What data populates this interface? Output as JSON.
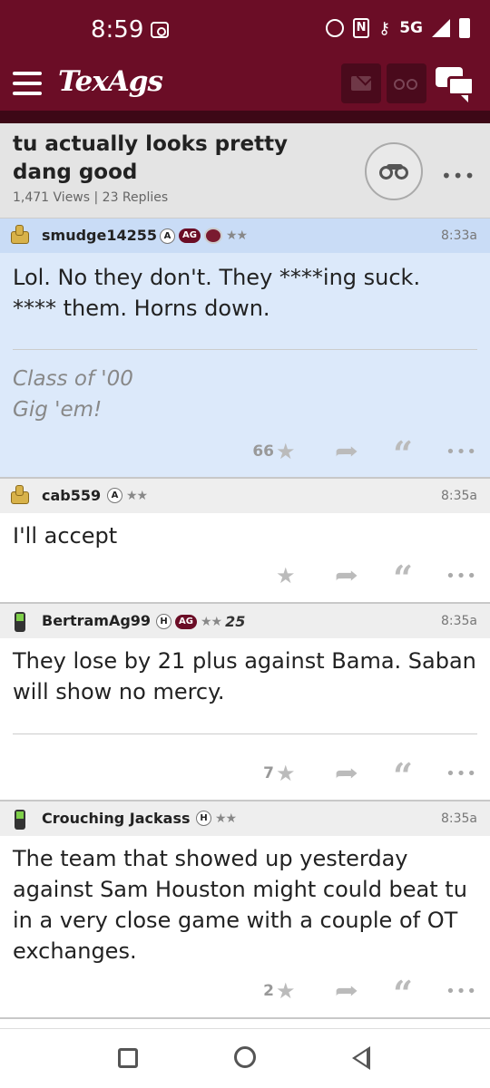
{
  "status_bar": {
    "time": "8:59",
    "network": "5G"
  },
  "app": {
    "name": "TexAgs"
  },
  "topic": {
    "title": "tu actually looks pretty dang good",
    "meta": "1,471 Views | 23 Replies"
  },
  "posts": [
    {
      "username": "smudge14255",
      "time": "8:33a",
      "badges": [
        "A",
        "AG"
      ],
      "stars": "★★",
      "body_lines": [
        "Lol. No they don't. They ****ing suck.",
        "**** them. Horns down."
      ],
      "signature_lines": [
        "Class of '00",
        "Gig 'em!"
      ],
      "star_count": "66",
      "highlighted": true
    },
    {
      "username": "cab559",
      "time": "8:35a",
      "badges": [
        "A"
      ],
      "stars": "★★",
      "body_lines": [
        "I'll accept"
      ],
      "star_count": ""
    },
    {
      "username": "BertramAg99",
      "time": "8:35a",
      "badges": [
        "H",
        "AG"
      ],
      "stars": "★★",
      "extra_badge": "25",
      "body_lines": [
        "They lose by 21 plus against Bama. Saban",
        "will show no mercy."
      ],
      "star_count": "7"
    },
    {
      "username": "Crouching Jackass",
      "time": "8:35a",
      "badges": [
        "H"
      ],
      "stars": "★★",
      "body_lines": [
        "The team that showed up yesterday",
        "against Sam Houston might could beat tu",
        "in a very close game with a couple of OT",
        "exchanges."
      ],
      "star_count": "2"
    }
  ],
  "colors": {
    "brand": "#6b0d26",
    "highlight": "#dce9fa",
    "header_gray": "#e4e4e4"
  }
}
